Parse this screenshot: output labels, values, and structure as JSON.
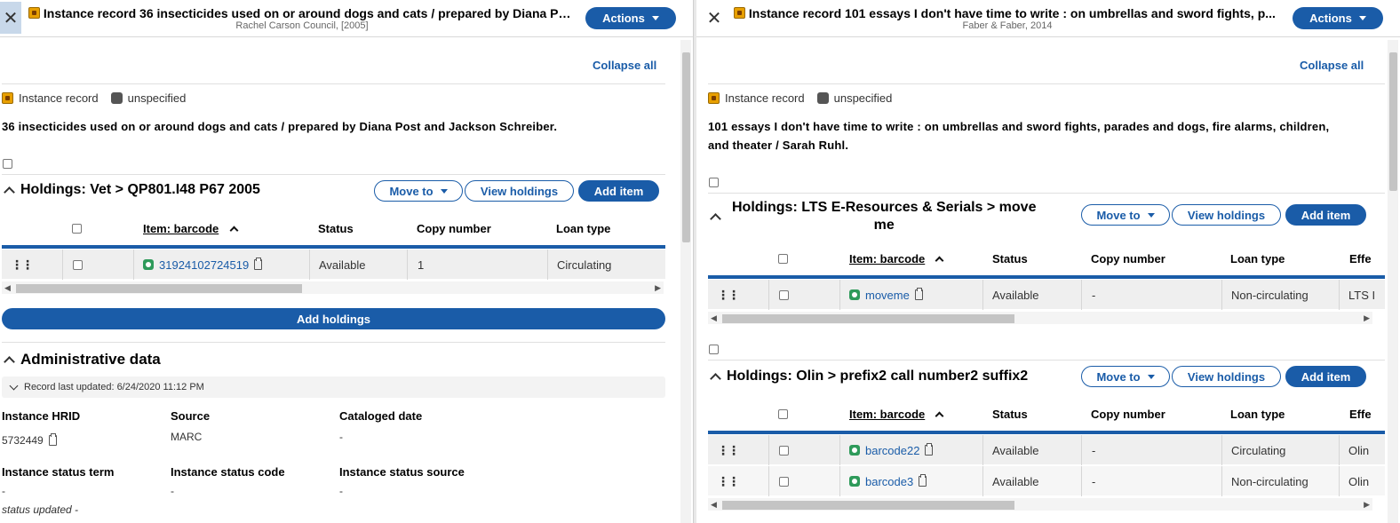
{
  "left": {
    "header": {
      "title": "Instance record 36 insecticides used on or around dogs and cats / prepared by Diana Pos...",
      "subtitle": "Rachel Carson Council, [2005]",
      "actions_label": "Actions"
    },
    "collapse_all": "Collapse all",
    "badges": {
      "instance_record": "Instance record",
      "unspecified": "unspecified"
    },
    "description": "36 insecticides used on or around dogs and cats / prepared by Diana Post and Jackson Schreiber.",
    "holdings": [
      {
        "title": "Holdings: Vet > QP801.I48 P67 2005",
        "move_to": "Move to",
        "view_holdings": "View holdings",
        "add_item": "Add item",
        "columns": [
          "Item: barcode",
          "Status",
          "Copy number",
          "Loan type"
        ],
        "rows": [
          {
            "barcode": "31924102724519",
            "status": "Available",
            "copy": "1",
            "loan": "Circulating"
          }
        ]
      }
    ],
    "add_holdings": "Add holdings",
    "admin": {
      "title": "Administrative data",
      "record_updated": "Record last updated: 6/24/2020 11:12 PM",
      "fields": [
        {
          "label": "Instance HRID",
          "value": "5732449"
        },
        {
          "label": "Source",
          "value": "MARC"
        },
        {
          "label": "Cataloged date",
          "value": "-"
        },
        {
          "label": "Instance status term",
          "value": "-"
        },
        {
          "label": "Instance status code",
          "value": "-"
        },
        {
          "label": "Instance status source",
          "value": "-"
        }
      ],
      "status_updated": "status updated -"
    }
  },
  "right": {
    "header": {
      "title": "Instance record 101 essays I don't have time to write : on umbrellas and sword fights, p...",
      "subtitle": "Faber & Faber, 2014",
      "actions_label": "Actions"
    },
    "collapse_all": "Collapse all",
    "badges": {
      "instance_record": "Instance record",
      "unspecified": "unspecified"
    },
    "description_line1": "101 essays I don't have time to write : on umbrellas and sword fights, parades and dogs, fire alarms, children,",
    "description_line2": "and theater / Sarah Ruhl.",
    "holdings": [
      {
        "title_line1": "Holdings: LTS E-Resources & Serials > move",
        "title_line2": "me",
        "move_to": "Move to",
        "view_holdings": "View holdings",
        "add_item": "Add item",
        "columns": [
          "Item: barcode",
          "Status",
          "Copy number",
          "Loan type",
          "Effe"
        ],
        "rows": [
          {
            "barcode": "moveme",
            "status": "Available",
            "copy": "-",
            "loan": "Non-circulating",
            "eff": "LTS I"
          }
        ]
      },
      {
        "title": "Holdings: Olin > prefix2 call number2 suffix2",
        "move_to": "Move to",
        "view_holdings": "View holdings",
        "add_item": "Add item",
        "columns": [
          "Item: barcode",
          "Status",
          "Copy number",
          "Loan type",
          "Effe"
        ],
        "rows": [
          {
            "barcode": "barcode22",
            "status": "Available",
            "copy": "-",
            "loan": "Circulating",
            "eff": "Olin"
          },
          {
            "barcode": "barcode3",
            "status": "Available",
            "copy": "-",
            "loan": "Non-circulating",
            "eff": "Olin"
          }
        ]
      }
    ]
  },
  "colors": {
    "accent": "#1a5ca8",
    "instance_icon": "#e8a000",
    "item_icon": "#2e9a5a"
  },
  "icons": [
    "close-icon",
    "instance-record-icon",
    "chevron-down-icon",
    "chevron-up-icon",
    "drag-handle-icon",
    "item-icon",
    "copy-icon"
  ]
}
